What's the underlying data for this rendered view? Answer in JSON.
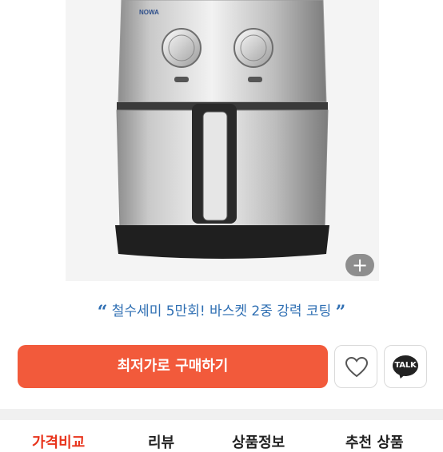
{
  "product": {
    "brand": "NOWA",
    "image_alt": "air fryer",
    "zoom_label": "+"
  },
  "tagline": {
    "open_quote": "“",
    "text": "철수세미 5만회! 바스켓 2중 강력 코팅",
    "close_quote": "”"
  },
  "actions": {
    "buy_label": "최저가로 구매하기",
    "talk_label": "TALK"
  },
  "tabs": [
    {
      "label": "가격비교",
      "active": true
    },
    {
      "label": "리뷰",
      "active": false
    },
    {
      "label": "상품정보",
      "active": false
    },
    {
      "label": "추천 상품",
      "active": false
    }
  ],
  "colors": {
    "accent": "#f25a3b",
    "tagline": "#2f6fb3",
    "active_tab": "#e8341c"
  }
}
